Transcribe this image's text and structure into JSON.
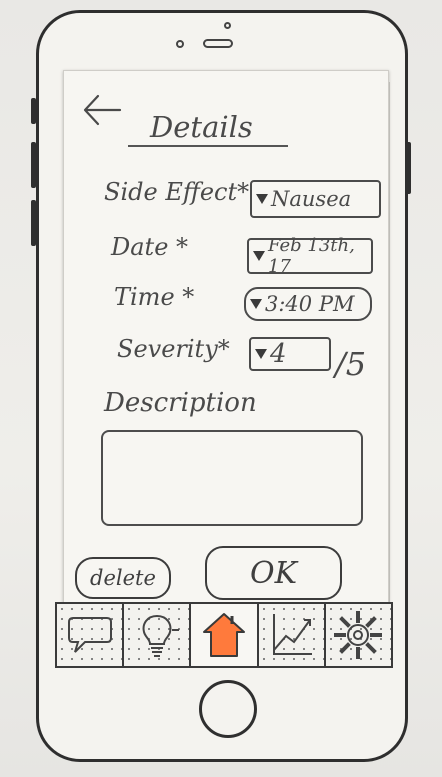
{
  "screen": {
    "title": "Details",
    "fields": {
      "side_effect": {
        "label": "Side Effect*",
        "value": "Nausea"
      },
      "date": {
        "label": "Date *",
        "value": "Feb 13th, 17"
      },
      "time": {
        "label": "Time *",
        "value": "3:40 PM"
      },
      "severity": {
        "label": "Severity*",
        "value": "4",
        "suffix": "/5"
      }
    },
    "description": {
      "label": "Description",
      "value": ""
    },
    "buttons": {
      "delete": "delete",
      "ok": "OK"
    }
  },
  "tabbar": {
    "tabs": [
      {
        "icon": "speech-bubble-icon",
        "active": false
      },
      {
        "icon": "lightbulb-icon",
        "active": false
      },
      {
        "icon": "home-icon",
        "active": true,
        "accent": "#ff7a3c"
      },
      {
        "icon": "line-chart-icon",
        "active": false
      },
      {
        "icon": "gear-icon",
        "active": false
      }
    ]
  }
}
